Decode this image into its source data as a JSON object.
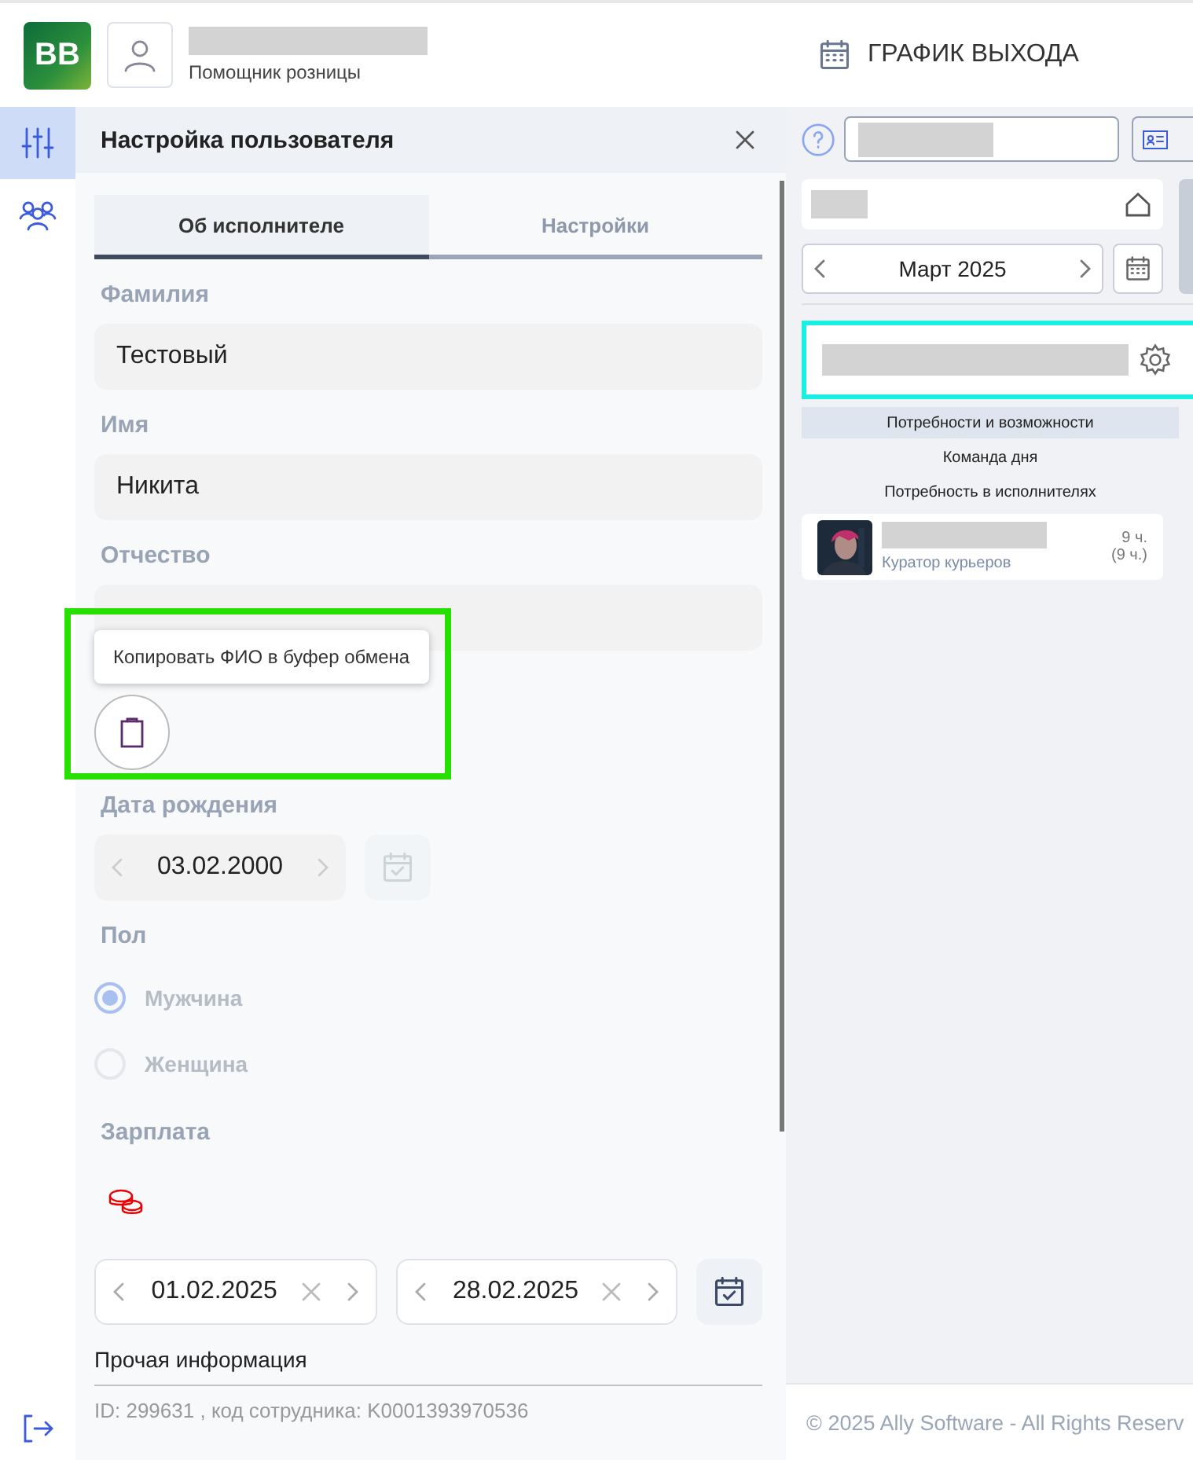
{
  "header": {
    "logo": "BB",
    "role": "Помощник розницы",
    "title": "ГРАФИК ВЫХОДА"
  },
  "rail": [
    {
      "kind": "sliders",
      "selected": true
    },
    {
      "kind": "users",
      "selected": false
    }
  ],
  "panel": {
    "title": "Настройка пользователя",
    "tabs": [
      {
        "label": "Об исполнителе",
        "selected": true
      },
      {
        "label": "Настройки",
        "selected": false
      }
    ],
    "fields": [
      {
        "label": "Фамилия",
        "value": "Тестовый"
      },
      {
        "label": "Имя",
        "value": "Никита"
      },
      {
        "label": "Отчество"
      }
    ],
    "tooltip": "Копировать ФИО в буфер обмена",
    "birth": {
      "label": "Дата рождения",
      "value": "03.02.2000",
      "disabled": true
    },
    "gender": {
      "label": "Пол",
      "disabled": true,
      "options": [
        {
          "label": "Мужчина",
          "selected": true
        },
        {
          "label": "Женщина",
          "selected": false
        }
      ]
    },
    "salary": {
      "label": "Зарплата",
      "from": "01.02.2025",
      "to": "28.02.2025"
    },
    "other": {
      "title": "Прочая информация",
      "text": "ID: 299631 , код сотрудника: K0001393970536"
    }
  },
  "schedule": {
    "month": "Март 2025",
    "sections": [
      {
        "label": "Потребности и возможности",
        "selected": true
      },
      {
        "label": "Команда дня",
        "selected": false
      },
      {
        "label": "Потребность в исполнителях",
        "selected": false
      }
    ],
    "person": {
      "role": "Куратор курьеров",
      "hours": "9 ч.",
      "hours_total": "(9 ч.)"
    }
  },
  "footer": "© 2025 Ally Software - All Rights Reserv"
}
